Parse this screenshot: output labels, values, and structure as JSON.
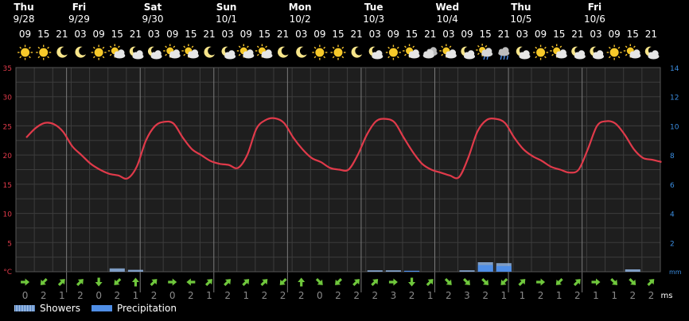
{
  "chart_data": {
    "type": "line",
    "title": "",
    "days": [
      {
        "name": "Thu",
        "date": "9/28"
      },
      {
        "name": "Fri",
        "date": "9/29"
      },
      {
        "name": "Sat",
        "date": "9/30"
      },
      {
        "name": "Sun",
        "date": "10/1"
      },
      {
        "name": "Mon",
        "date": "10/2"
      },
      {
        "name": "Tue",
        "date": "10/3"
      },
      {
        "name": "Wed",
        "date": "10/4"
      },
      {
        "name": "Thu",
        "date": "10/5"
      },
      {
        "name": "Fri",
        "date": "10/6"
      }
    ],
    "hours": [
      "09",
      "15",
      "21",
      "03",
      "09",
      "15",
      "21",
      "03",
      "09",
      "15",
      "21",
      "03",
      "09",
      "15",
      "21",
      "03",
      "09",
      "15",
      "21",
      "03",
      "09",
      "15",
      "21",
      "03",
      "09",
      "15",
      "21",
      "03",
      "09",
      "15",
      "21",
      "03",
      "09",
      "15",
      "21"
    ],
    "weather_icons": [
      "sun",
      "sun",
      "moon",
      "moon",
      "sun",
      "sun-cloud",
      "moon-cloud",
      "moon-cloud",
      "sun-cloud",
      "sun-cloud",
      "moon",
      "moon-cloud",
      "sun-cloud",
      "sun-cloud",
      "moon",
      "moon",
      "sun",
      "sun",
      "moon",
      "moon-cloud",
      "sun",
      "sun-cloud",
      "cloud",
      "sun-cloud",
      "moon-cloud",
      "sun-cloud-rain",
      "cloud-rain",
      "moon-cloud",
      "sun",
      "sun-cloud",
      "moon-cloud",
      "moon-cloud",
      "sun",
      "sun-cloud",
      "moon-cloud"
    ],
    "temperature": {
      "unit_label": "°C",
      "ylim": [
        0,
        35
      ],
      "ticks": [
        5,
        10,
        15,
        20,
        25,
        30,
        35
      ],
      "x": [
        0,
        0.5,
        1,
        1.5,
        2,
        2.5,
        3,
        3.5,
        4,
        4.5,
        5,
        5.5,
        6,
        6.5,
        7,
        7.5,
        8,
        8.5,
        9,
        9.5,
        10,
        10.5,
        11,
        11.5,
        12,
        12.5,
        13,
        13.5,
        14,
        14.5,
        15,
        15.5,
        16,
        16.5,
        17,
        17.5,
        18,
        18.5,
        19,
        19.5,
        20,
        20.5,
        21,
        21.5,
        22,
        22.5,
        23,
        23.5,
        24,
        24.5,
        25,
        25.5,
        26,
        26.5,
        27,
        27.5,
        28,
        28.5,
        29,
        29.5,
        30,
        30.5,
        31,
        31.5,
        32,
        32.5,
        33,
        33.5,
        34,
        34.5
      ],
      "values": [
        23,
        24.6,
        25.5,
        25.3,
        24,
        21.5,
        20,
        18.5,
        17.5,
        16.8,
        16.5,
        16,
        18,
        22.5,
        25,
        25.7,
        25.4,
        23,
        21,
        20,
        19,
        18.5,
        18.3,
        17.8,
        20,
        24.5,
        26,
        26.3,
        25.5,
        23,
        21,
        19.5,
        18.8,
        17.8,
        17.5,
        17.5,
        20,
        23.5,
        25.8,
        26.2,
        25.6,
        23,
        20.5,
        18.5,
        17.5,
        17,
        16.5,
        16.2,
        19.5,
        24,
        26,
        26.2,
        25.5,
        23,
        21,
        19.8,
        19,
        18,
        17.5,
        17,
        17.5,
        21,
        25,
        25.8,
        25.4,
        23.5,
        21,
        19.5,
        19.2,
        18.8
      ]
    },
    "wind": {
      "unit_label": "ms",
      "ylim": [
        0,
        14
      ],
      "ticks": [
        2,
        4,
        6,
        8,
        10,
        12,
        14
      ],
      "speeds": [
        "0",
        "2",
        "1",
        "2",
        "0",
        "2",
        "1",
        "2",
        "0",
        "2",
        "1",
        "2",
        "1",
        "2",
        "2",
        "2",
        "0",
        "2",
        "2",
        "2",
        "3",
        "2",
        "1",
        "2",
        "3",
        "2",
        "1",
        "1",
        "2",
        "1",
        "2",
        "1",
        "1",
        "2",
        "2"
      ],
      "directions": [
        "E",
        "SW",
        "NE",
        "NE",
        "S",
        "SW",
        "N",
        "NE",
        "E",
        "W",
        "NE",
        "NE",
        "NE",
        "NE",
        "SW",
        "N",
        "SE",
        "SW",
        "NE",
        "NE",
        "E",
        "S",
        "NE",
        "SE",
        "SE",
        "SE",
        "SW",
        "NE",
        "E",
        "SW",
        "NE",
        "E",
        "SE",
        "SE",
        "NE"
      ]
    },
    "precipitation": {
      "unit_label": "mm",
      "showers": [
        0,
        0,
        0,
        0,
        0,
        0.35,
        0.2,
        0,
        0,
        0,
        0,
        0,
        0,
        0,
        0,
        0,
        0,
        0,
        0,
        0.15,
        0.15,
        0,
        0,
        0,
        0.15,
        1.0,
        0.9,
        0,
        0,
        0,
        0,
        0,
        0,
        0.25,
        0
      ],
      "precip": [
        0,
        0,
        0,
        0,
        0,
        0,
        0,
        0,
        0,
        0,
        0,
        0,
        0,
        0,
        0,
        0,
        0,
        0,
        0,
        0,
        0,
        0.1,
        0,
        0,
        0,
        0.7,
        0.6,
        0,
        0,
        0,
        0,
        0,
        0,
        0,
        0
      ]
    },
    "legend": [
      {
        "key": "showers",
        "label": "Showers"
      },
      {
        "key": "precip",
        "label": "Precipitation"
      }
    ],
    "colors": {
      "background": "#000000",
      "plot": "#1e1e1e",
      "grid": "#3c3c3c",
      "day_divider": "#7a7a7a",
      "temp_line": "#e03a4a",
      "temp_axis": "#e03a4a",
      "right_axis": "#3b8de0",
      "wind_arrow": "#6fc73c",
      "wind_text": "#8a8a8a",
      "precip": "#4f8ee6",
      "text": "#ffffff"
    }
  }
}
